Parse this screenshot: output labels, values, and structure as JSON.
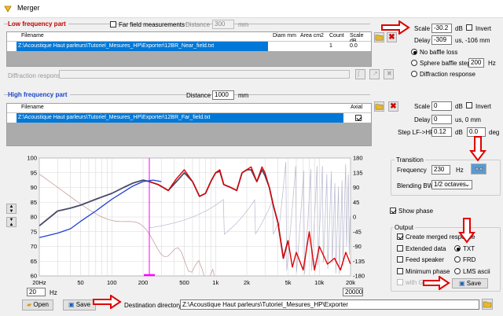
{
  "window": {
    "title": "Merger"
  },
  "lf": {
    "title": "Low frequency part",
    "farfield_label": "Far field measurements",
    "distance_label": "Distance",
    "distance_value": "300",
    "distance_unit": "mm",
    "columns": [
      "Filename",
      "Diam mm",
      "Area cm2",
      "Count",
      "Scale dB"
    ],
    "row": {
      "filename": "Z:\\Acoustique Haut parleurs\\Tutoriel_Mesures_HP\\Exporter\\12BR_Near_field.txt",
      "diam": "",
      "area": "",
      "count": "1",
      "scale": "0.0"
    },
    "diffraction_label": "Diffraction response",
    "scale_label": "Scale",
    "scale_value": "-30.2",
    "scale_unit": "dB",
    "invert_label": "Invert",
    "delay_label": "Delay",
    "delay_value": "-309",
    "delay_unit": "us, -106 mm",
    "baffle_options": [
      "No baffle loss",
      "Sphere baffle step",
      "Diffraction response"
    ],
    "sphere_value": "200",
    "sphere_unit": "Hz"
  },
  "hf": {
    "title": "High frequency part",
    "distance_label": "Distance",
    "distance_value": "1000",
    "distance_unit": "mm",
    "columns": [
      "Filename",
      "Axial"
    ],
    "row": {
      "filename": "Z:\\Acoustique Haut parleurs\\Tutoriel_Mesures_HP\\Exporter\\12BR_Far_field.txt",
      "axial": true
    },
    "scale_label": "Scale",
    "scale_value": "0",
    "scale_unit": "dB",
    "invert_label": "Invert",
    "delay_label": "Delay",
    "delay_value": "0",
    "delay_unit": "us, 0 mm",
    "step_label": "Step LF->HF",
    "step_value": "0.12",
    "step_unit": "dB",
    "step_value2": "0.0",
    "step_unit2": "deg"
  },
  "transition": {
    "title": "Transition",
    "freq_label": "Frequency",
    "freq_value": "230",
    "freq_unit": "Hz",
    "blend_label": "Blending BW",
    "blend_value": "1/2 octaves"
  },
  "show_phase_label": "Show phase",
  "output": {
    "title": "Output",
    "create_label": "Create merged response",
    "extended_label": "Extended data",
    "feed_label": "Feed speaker",
    "minphase_label": "Minimum phase",
    "withgd_label": "with GD of HF",
    "formats": [
      "TXT",
      "FRD",
      "LMS ascii"
    ],
    "save_label": "Save"
  },
  "bottom": {
    "open_label": "Open",
    "save_label": "Save",
    "dest_label": "Destination directory",
    "dest_value": "Z:\\Acoustique Haut parleurs\\Tutoriel_Mesures_HP\\Exporter",
    "fmin_value": "20",
    "fmin_unit": "Hz",
    "fmax_value": "20000"
  },
  "chart_data": {
    "type": "line",
    "x_scale": "log",
    "xlim": [
      20,
      20000
    ],
    "ylim_left": [
      60,
      100
    ],
    "ylim_right": [
      -180,
      180
    ],
    "left_ticks": [
      "100",
      "95",
      "90",
      "85",
      "80",
      "75",
      "70",
      "65",
      "60"
    ],
    "right_ticks": [
      "180",
      "135",
      "90",
      "45",
      "0",
      "-45",
      "-90",
      "-135",
      "-180"
    ],
    "x_ticks": [
      "20Hz",
      "50",
      "100",
      "200",
      "500",
      "1k",
      "2k",
      "5k",
      "10k",
      "20k"
    ],
    "transition_marker": 230,
    "colors": {
      "near": "#1f3fd0",
      "far": "#e00000",
      "merged": "#4a4a6a",
      "phase": "#b8b8d0",
      "lf_phase": "#c8a0a0",
      "marker": "#ff00ff"
    },
    "series": [
      {
        "key": "near",
        "x": [
          20,
          30,
          40,
          50,
          70,
          100,
          130,
          160,
          200,
          250,
          300
        ],
        "y": [
          73,
          74.5,
          76,
          78.5,
          82,
          86,
          88.5,
          90.5,
          92,
          92.5,
          92
        ]
      },
      {
        "key": "far",
        "x": [
          230,
          280,
          350,
          420,
          500,
          600,
          700,
          800,
          900,
          1000,
          1100,
          1200,
          1400,
          1600,
          1800,
          2000,
          2200,
          2500,
          2800,
          3000,
          3300,
          3600,
          4000,
          4500,
          5000,
          5500,
          6000,
          7000,
          8000,
          9000,
          10000,
          12000,
          14000,
          16000,
          18000,
          20000
        ],
        "y": [
          92,
          91,
          89,
          93,
          96,
          92,
          87,
          88,
          92,
          95,
          96,
          91,
          90,
          89,
          95,
          96,
          97,
          92,
          97,
          95,
          90,
          84,
          78,
          66,
          72,
          63,
          68,
          62,
          75,
          62,
          70,
          64,
          66,
          62,
          68,
          64
        ]
      },
      {
        "key": "merged",
        "x": [
          20,
          30,
          40,
          50,
          70,
          100,
          130,
          160,
          200,
          230,
          280,
          350,
          420,
          500,
          600,
          700,
          800,
          900,
          1000,
          1100,
          1200,
          1400,
          1600,
          1800,
          2000,
          2200,
          2500,
          2800,
          3000,
          3300,
          3600,
          4000,
          4500,
          5000
        ],
        "y": [
          77,
          82,
          83,
          84,
          86,
          88,
          90,
          91.5,
          92.5,
          92,
          91,
          89,
          92,
          95,
          92,
          87,
          88,
          92,
          95,
          95.5,
          91,
          90,
          89,
          95,
          96,
          96,
          92,
          96,
          94,
          90,
          84,
          78,
          66,
          72
        ]
      }
    ]
  }
}
